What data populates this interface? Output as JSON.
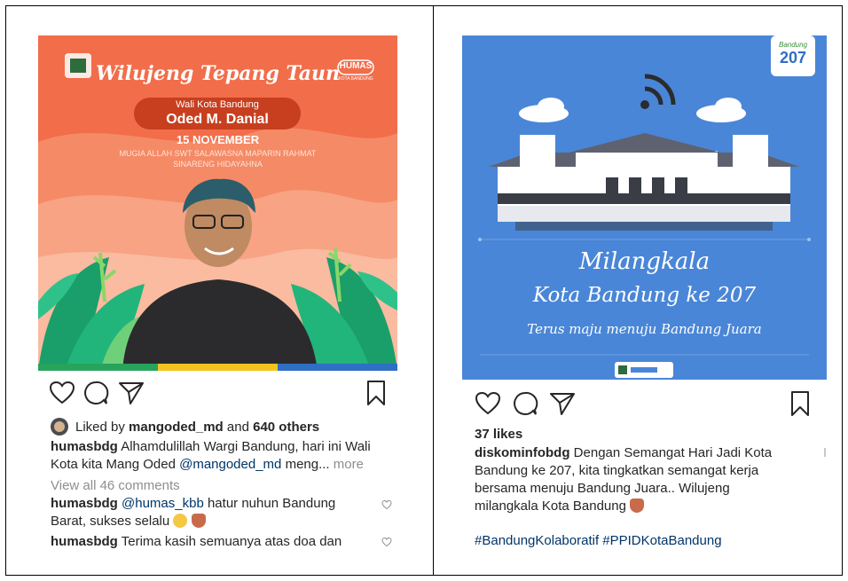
{
  "left_post": {
    "image": {
      "title": "Wilujeng Tepang Taun",
      "badge": "HUMAS",
      "badge_sub": "KOTA BANDUNG",
      "role": "Wali Kota Bandung",
      "name": "Oded M. Danial",
      "date": "15 NOVEMBER",
      "prayer_line1": "MUGIA ALLAH SWT SALAWASNA MAPARIN RAHMAT",
      "prayer_line2": "SINARENG HIDAYAHNA",
      "bg_color": "#f26d4a"
    },
    "liked_by_prefix": "Liked by",
    "liked_by_user": "mangoded_md",
    "liked_and": "and",
    "liked_others": "640 others",
    "caption_user": "humasbdg",
    "caption_text_1": "Alhamdulillah Wargi Bandung, hari ini Wali Kota kita Mang Oded",
    "caption_mention": "@mangoded_md",
    "caption_text_2": "meng...",
    "more_label": "more",
    "view_comments": "View all 46 comments",
    "comment1_user": "humasbdg",
    "comment1_mention": "@humas_kbb",
    "comment1_text": "hatur nuhun Bandung Barat, sukses selalu",
    "comment2_user": "humasbdg",
    "comment2_text": "Terima kasih semuanya atas doa dan"
  },
  "right_post": {
    "image": {
      "logo_text": "Bandung",
      "logo_number": "207",
      "line1": "Milangkala",
      "line2": "Kota Bandung ke 207",
      "line3": "Terus maju menuju Bandung Juara",
      "bg_color": "#4a86d7"
    },
    "likes": "37 likes",
    "caption_user": "diskominfobdg",
    "caption_text": "Dengan Semangat Hari Jadi Kota Bandung ke 207, kita tingkatkan semangat kerja bersama menuju Bandung Juara.. Wilujeng milangkala Kota Bandung",
    "hashtags": "#BandungKolaboratif #PPIDKotaBandung"
  },
  "icons": [
    "heart-icon",
    "comment-icon",
    "share-icon",
    "bookmark-icon"
  ]
}
